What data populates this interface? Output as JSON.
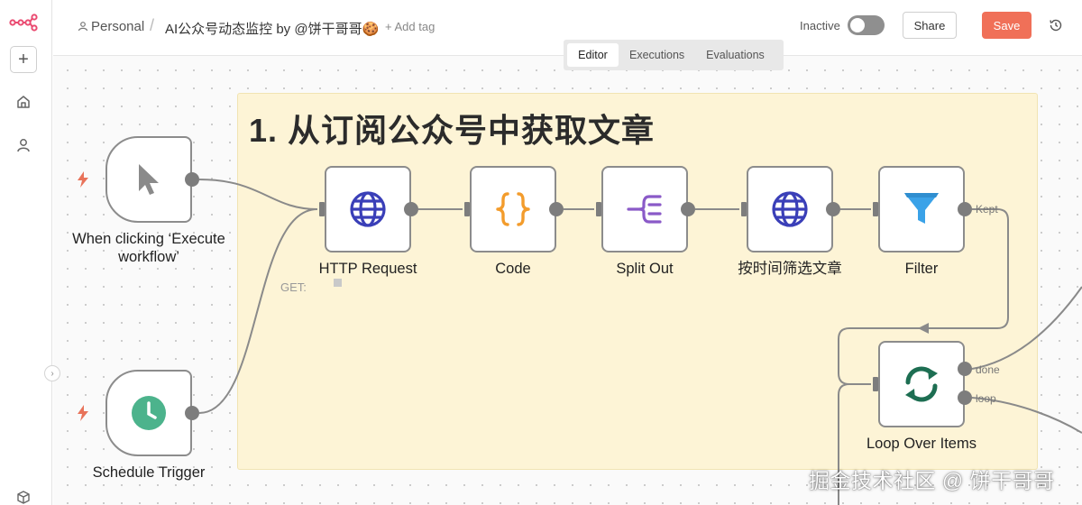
{
  "header": {
    "project": "Personal",
    "separator": "/",
    "workflow_title": "AI公众号动态监控 by @饼干哥哥🍪",
    "add_tag": "+ Add tag",
    "status_label": "Inactive",
    "share_label": "Share",
    "save_label": "Save"
  },
  "tabs": [
    {
      "label": "Editor",
      "active": true
    },
    {
      "label": "Executions",
      "active": false
    },
    {
      "label": "Evaluations",
      "active": false
    }
  ],
  "sticky_note": {
    "title": "1. 从订阅公众号中获取文章"
  },
  "nodes": {
    "manual_trigger": {
      "label_line1": "When clicking ‘Execute",
      "label_line2": "workflow’"
    },
    "schedule_trigger": {
      "label": "Schedule Trigger"
    },
    "http_request": {
      "label": "HTTP Request",
      "hint": "GET:"
    },
    "code": {
      "label": "Code"
    },
    "split_out": {
      "label": "Split Out"
    },
    "filter_by_time": {
      "label": "按时间筛选文章"
    },
    "filter": {
      "label": "Filter",
      "output": "Kept"
    },
    "loop": {
      "label": "Loop Over Items",
      "output_done": "done",
      "output_loop": "loop"
    }
  },
  "watermark": "掘金技术社区 @ 饼干哥哥",
  "colors": {
    "save": "#f07058",
    "sticky": "#fdf4d6",
    "globe": "#3a3fb8",
    "code": "#f39c2c",
    "split": "#8a5ac8",
    "filter": "#3aa2e8",
    "loop": "#1d6e52",
    "clock": "#4cb38c",
    "trigger_bolt": "#e8735a"
  }
}
